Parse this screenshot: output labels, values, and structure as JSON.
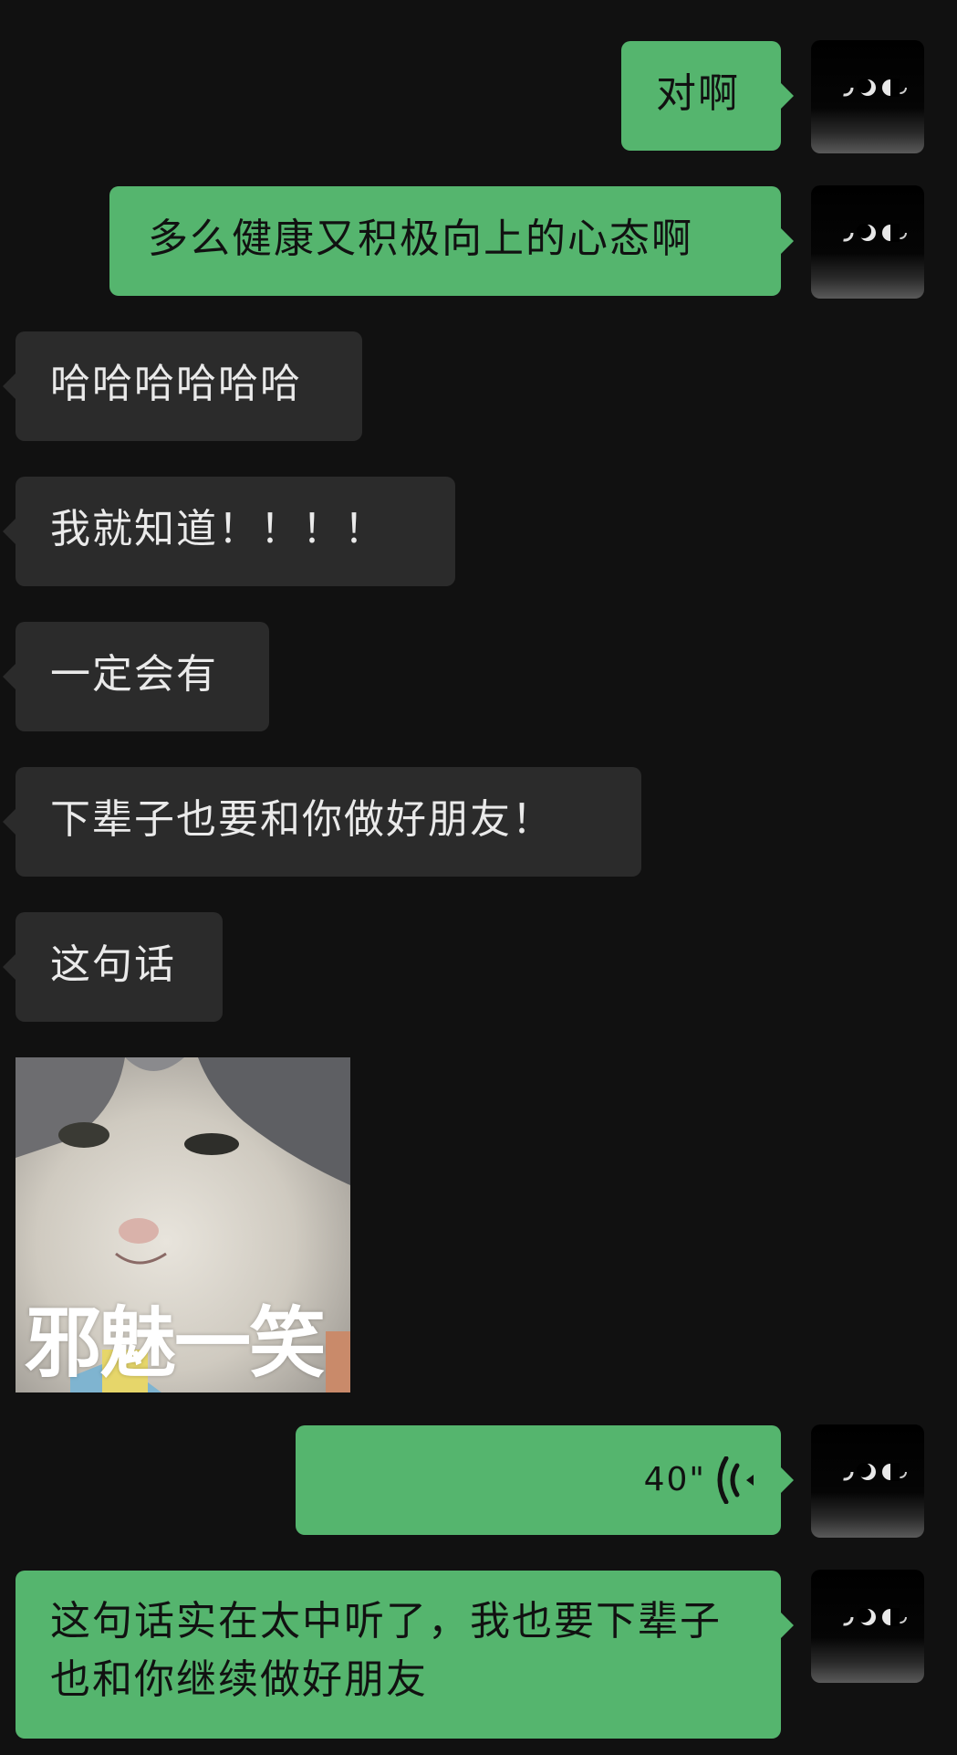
{
  "messages": [
    {
      "side": "out",
      "text": "对啊"
    },
    {
      "side": "out",
      "text": "多么健康又积极向上的心态啊"
    },
    {
      "side": "in",
      "text": "哈哈哈哈哈哈"
    },
    {
      "side": "in",
      "text": "我就知道！！！！"
    },
    {
      "side": "in",
      "text": "一定会有"
    },
    {
      "side": "in",
      "text": "下辈子也要和你做好朋友！"
    },
    {
      "side": "in",
      "text": "这句话"
    },
    {
      "side": "in",
      "sticker_caption": "邪魅一笑"
    },
    {
      "side": "out",
      "voice_duration": "40\""
    },
    {
      "side": "out",
      "text": "这句话实在太中听了，我也要下辈子也和你继续做好朋友"
    }
  ],
  "avatar": {
    "icon": "moon-phases-icon"
  },
  "colors": {
    "background": "#111111",
    "incoming_bubble": "#2b2b2b",
    "outgoing_bubble": "#55b56e"
  }
}
